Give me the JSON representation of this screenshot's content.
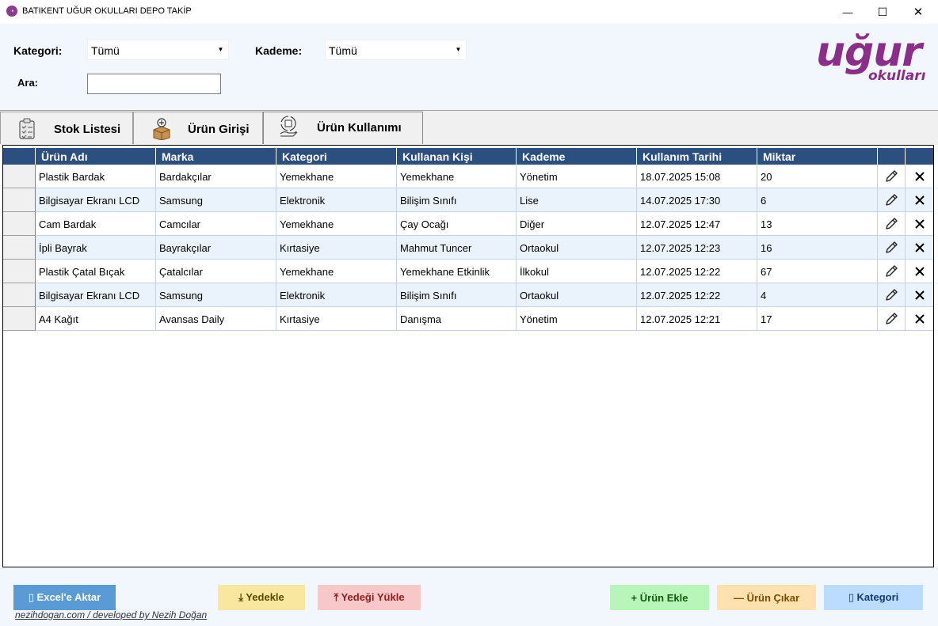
{
  "window": {
    "title": "BATIKENT UĞUR OKULLARI DEPO TAKİP",
    "minimize_glyph": "—",
    "maximize_glyph": "☐",
    "close_glyph": "✕"
  },
  "filters": {
    "kategori_label": "Kategori:",
    "kategori_value": "Tümü",
    "kademe_label": "Kademe:",
    "kademe_value": "Tümü",
    "ara_label": "Ara:",
    "ara_value": ""
  },
  "logo": {
    "main": "uğur",
    "sub": "okulları",
    "color": "#8b2e8a"
  },
  "tabs": [
    {
      "label": "Stok Listesi",
      "icon": "clipboard-checklist-icon"
    },
    {
      "label": "Ürün Girişi",
      "icon": "box-add-icon"
    },
    {
      "label": "Ürün Kullanımı",
      "icon": "box-hand-icon",
      "selected": true
    }
  ],
  "table": {
    "header_color": "#2b5080",
    "columns": [
      "Ürün Adı",
      "Marka",
      "Kategori",
      "Kullanan Kişi",
      "Kademe",
      "Kullanım Tarihi",
      "Miktar"
    ],
    "rows": [
      [
        "Plastik Bardak",
        "Bardakçılar",
        "Yemekhane",
        "Yemekhane",
        "Yönetim",
        "18.07.2025 15:08",
        "20"
      ],
      [
        "Bilgisayar Ekranı LCD",
        "Samsung",
        "Elektronik",
        "Bilişim Sınıfı",
        "Lise",
        "14.07.2025 17:30",
        "6"
      ],
      [
        "Cam Bardak",
        "Camcılar",
        "Yemekhane",
        "Çay Ocağı",
        "Diğer",
        "12.07.2025 12:47",
        "13"
      ],
      [
        "İpli Bayrak",
        "Bayrakçılar",
        "Kırtasiye",
        "Mahmut Tuncer",
        "Ortaokul",
        "12.07.2025 12:23",
        "16"
      ],
      [
        "Plastik Çatal Bıçak",
        "Çatalcılar",
        "Yemekhane",
        "Yemekhane Etkinlik",
        "İlkokul",
        "12.07.2025 12:22",
        "67"
      ],
      [
        "Bilgisayar Ekranı LCD",
        "Samsung",
        "Elektronik",
        "Bilişim Sınıfı",
        "Ortaokul",
        "12.07.2025 12:22",
        "4"
      ],
      [
        "A4 Kağıt",
        "Avansas Daily",
        "Kırtasiye",
        "Danışma",
        "Yönetim",
        "12.07.2025 12:21",
        "17"
      ]
    ]
  },
  "buttons": {
    "excel": {
      "label": "▯ Excel'e  Aktar",
      "color": "#5b9bd5"
    },
    "yedekle": {
      "label": "⤓ Yedekle",
      "color": "#f9e79f"
    },
    "yedegi_yukle": {
      "label": "⤒ Yedeği  Yükle",
      "color": "#f8c8c8"
    },
    "urun_ekle": {
      "label": "+ Ürün  Ekle",
      "color": "#b8f5b8"
    },
    "urun_cikar": {
      "label": "— Ürün  Çıkar",
      "color": "#fde2b0"
    },
    "kategori": {
      "label": "▯ Kategori",
      "color": "#bcdcff"
    }
  },
  "footer": "nezihdogan.com / developed by Nezih Doğan"
}
